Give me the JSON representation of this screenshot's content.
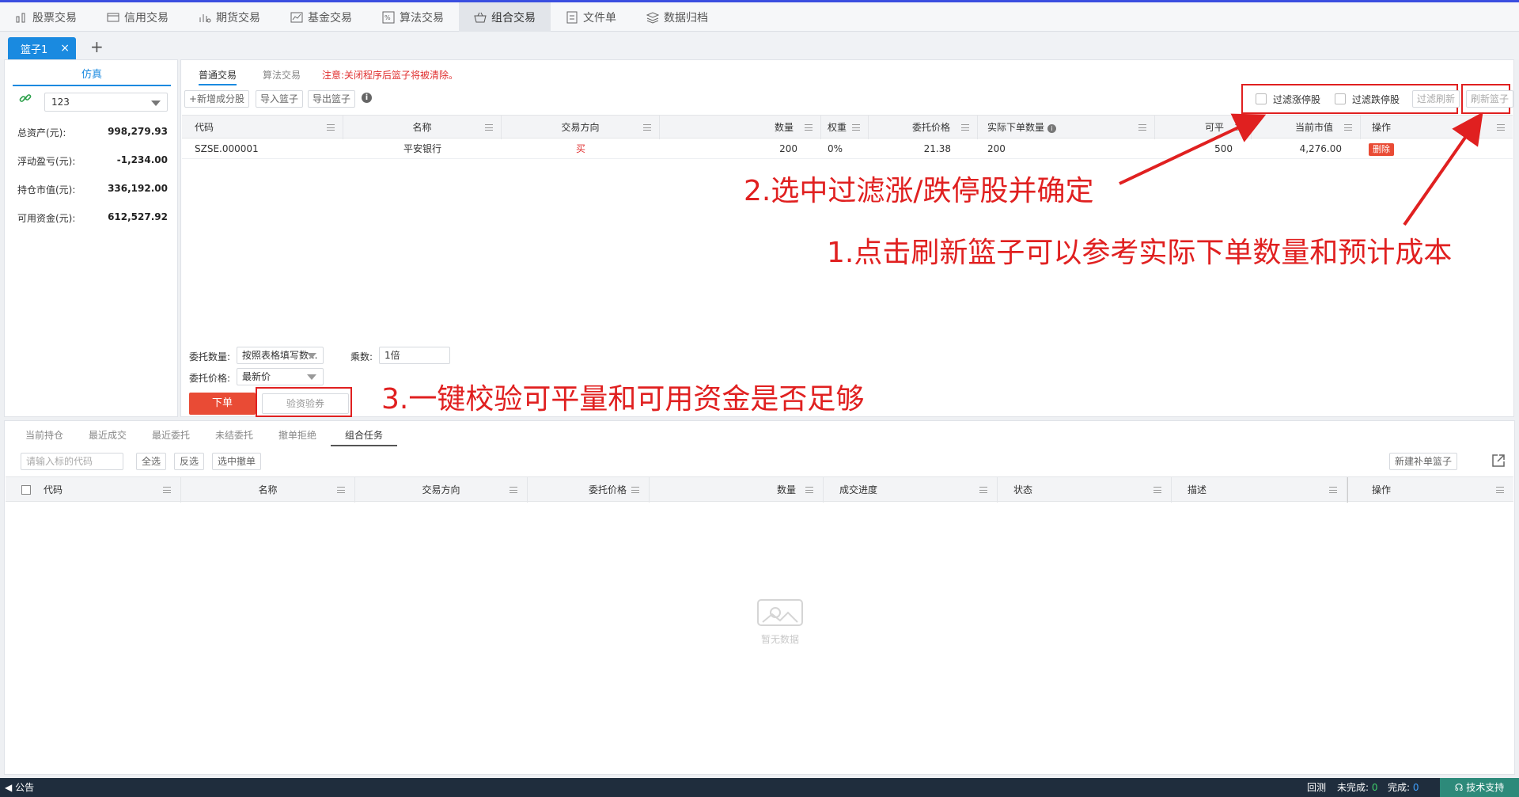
{
  "nav": {
    "items": [
      {
        "label": "股票交易",
        "icon": "stock-icon"
      },
      {
        "label": "信用交易",
        "icon": "credit-card-icon"
      },
      {
        "label": "期货交易",
        "icon": "futures-icon"
      },
      {
        "label": "基金交易",
        "icon": "fund-icon"
      },
      {
        "label": "算法交易",
        "icon": "algo-icon"
      },
      {
        "label": "组合交易",
        "icon": "basket-icon"
      },
      {
        "label": "文件单",
        "icon": "file-icon"
      },
      {
        "label": "数据归档",
        "icon": "archive-icon"
      }
    ],
    "active_index": 5
  },
  "basket_tabs": {
    "tab1": "篮子1",
    "close": "×",
    "add": "+"
  },
  "left": {
    "title": "仿真",
    "account": "123",
    "rows": [
      {
        "label": "总资产(元):",
        "value": "998,279.93"
      },
      {
        "label": "浮动盈亏(元):",
        "value": "-1,234.00"
      },
      {
        "label": "持仓市值(元):",
        "value": "336,192.00"
      },
      {
        "label": "可用资金(元):",
        "value": "612,527.92"
      }
    ]
  },
  "main": {
    "tabs": [
      "普通交易",
      "算法交易"
    ],
    "notice": "注意:关闭程序后篮子将被清除。",
    "toolbar": {
      "add": "+新增成分股",
      "import": "导入篮子",
      "export": "导出篮子"
    },
    "filter_up": "过滤涨停股",
    "filter_down": "过滤跌停股",
    "filter_refresh": "过滤刷新",
    "refresh_basket": "刷新篮子",
    "columns": [
      "代码",
      "名称",
      "交易方向",
      "数量",
      "权重",
      "委托价格",
      "实际下单数量",
      "可平",
      "当前市值",
      "操作"
    ],
    "rows": [
      {
        "code": "SZSE.000001",
        "name": "平安银行",
        "side": "买",
        "qty": "200",
        "weight": "0%",
        "price": "21.38",
        "actual_qty": "200",
        "closable": "500",
        "mkt_value": "4,276.00",
        "action": "删除"
      }
    ],
    "form": {
      "qty_label": "委托数量:",
      "qty_value": "按照表格填写数...",
      "mult_label": "乘数:",
      "mult_value": "1倍",
      "price_label": "委托价格:",
      "price_value": "最新价"
    },
    "order_btn": "下单",
    "verify_btn": "验资验券"
  },
  "annotations": {
    "a1": "1.点击刷新篮子可以参考实际下单数量和预计成本",
    "a2": "2.选中过滤涨/跌停股并确定",
    "a3": "3.一键校验可平量和可用资金是否足够",
    "color": "#e02020"
  },
  "bottom": {
    "tabs": [
      "当前持仓",
      "最近成交",
      "最近委托",
      "未结委托",
      "撤单拒绝",
      "组合任务"
    ],
    "active_index": 5,
    "search_placeholder": "请输入标的代码",
    "select_all": "全选",
    "invert": "反选",
    "cancel_selected": "选中撤单",
    "new_order_basket": "新建补单篮子",
    "columns": [
      "代码",
      "名称",
      "交易方向",
      "委托价格",
      "数量",
      "成交进度",
      "状态",
      "描述",
      "操作"
    ],
    "empty": "暂无数据"
  },
  "status": {
    "announce": "公告",
    "replay": "回测",
    "pending_label": "未完成:",
    "pending": "0",
    "done_label": "完成:",
    "done": "0",
    "support": "技术支持"
  }
}
